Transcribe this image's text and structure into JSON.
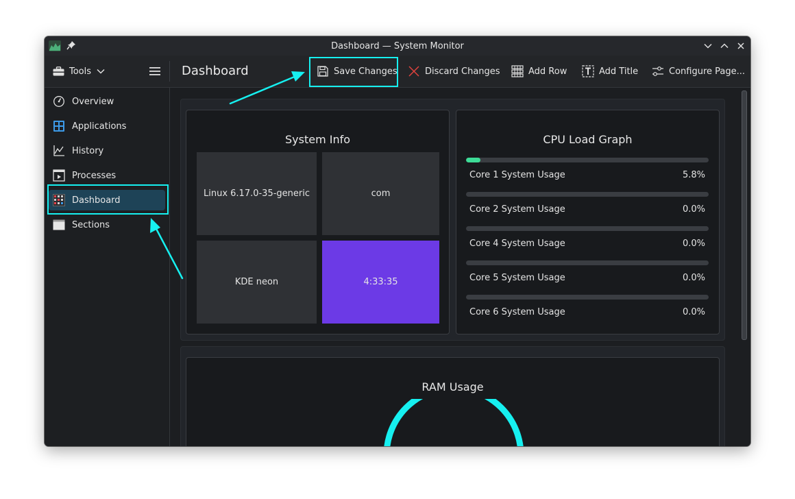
{
  "window": {
    "title": "Dashboard — System Monitor"
  },
  "toolbar": {
    "tools_label": "Tools",
    "page_title": "Dashboard",
    "buttons": [
      {
        "label": "Save Changes",
        "icon": "save-icon"
      },
      {
        "label": "Discard Changes",
        "icon": "discard-icon"
      },
      {
        "label": "Add Row",
        "icon": "add-row-icon"
      },
      {
        "label": "Add Title",
        "icon": "add-title-icon"
      },
      {
        "label": "Configure Page...",
        "icon": "configure-icon"
      }
    ]
  },
  "sidebar": {
    "items": [
      {
        "label": "Overview",
        "icon": "gauge-icon"
      },
      {
        "label": "Applications",
        "icon": "applications-icon"
      },
      {
        "label": "History",
        "icon": "history-chart-icon"
      },
      {
        "label": "Processes",
        "icon": "processes-icon"
      },
      {
        "label": "Dashboard",
        "icon": "dashboard-icon",
        "active": true
      },
      {
        "label": "Sections",
        "icon": "sections-icon"
      }
    ]
  },
  "system_info": {
    "title": "System Info",
    "tiles": [
      {
        "text": "Linux 6.17.0-35-generic"
      },
      {
        "text": "com"
      },
      {
        "text": "KDE neon"
      },
      {
        "text": "4:33:35",
        "highlight": true
      }
    ]
  },
  "cpu": {
    "title": "CPU Load Graph",
    "cores": [
      {
        "label": "Core 1 System Usage",
        "value": "5.8%",
        "percent": 5.8
      },
      {
        "label": "Core 2 System Usage",
        "value": "0.0%",
        "percent": 0
      },
      {
        "label": "Core 4 System Usage",
        "value": "0.0%",
        "percent": 0
      },
      {
        "label": "Core 5 System Usage",
        "value": "0.0%",
        "percent": 0
      },
      {
        "label": "Core 6 System Usage",
        "value": "0.0%",
        "percent": 0
      }
    ]
  },
  "ram": {
    "title": "RAM Usage"
  },
  "colors": {
    "accent_cyan": "#16f0f0",
    "highlight_purple": "#6c3ae6",
    "core_fill": "#3ddc97",
    "active_item": "#1e4357"
  }
}
